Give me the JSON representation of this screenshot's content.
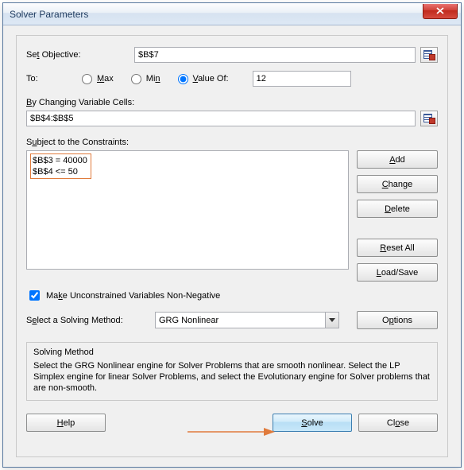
{
  "window": {
    "title": "Solver Parameters"
  },
  "objective": {
    "label_prefix": "Se",
    "label_under": "t",
    "label_suffix": " Objective:",
    "value": "$B$7"
  },
  "to": {
    "label": "To:",
    "max": {
      "under": "M",
      "rest": "ax"
    },
    "min": {
      "pre": "Mi",
      "under": "n"
    },
    "valueof": {
      "under": "V",
      "rest": "alue Of:"
    },
    "selected": "valueof",
    "value_input": "12"
  },
  "changing": {
    "under": "B",
    "rest": "y Changing Variable Cells:",
    "value": "$B$4:$B$5"
  },
  "constraints": {
    "label_pre": "S",
    "label_under": "u",
    "label_post": "bject to the Constraints:",
    "items": [
      "$B$3 = 40000",
      "$B$4 <= 50"
    ],
    "add": {
      "under": "A",
      "rest": "dd"
    },
    "change": {
      "under": "C",
      "rest": "hange"
    },
    "delete": {
      "under": "D",
      "rest": "elete"
    },
    "reset": {
      "under": "R",
      "rest": "eset All"
    },
    "loadsave": {
      "under": "L",
      "rest": "oad/Save"
    }
  },
  "nonneg": {
    "checked": true,
    "pre": "Ma",
    "under": "k",
    "post": "e Unconstrained Variables Non-Negative"
  },
  "method": {
    "label_pre": "S",
    "label_under": "e",
    "label_post": "lect a Solving Method:",
    "value": "GRG Nonlinear",
    "options": {
      "pre": "O",
      "under": "p",
      "post": "tions"
    }
  },
  "info": {
    "title": "Solving Method",
    "text": "Select the GRG Nonlinear engine for Solver Problems that are smooth nonlinear. Select the LP Simplex engine for linear Solver Problems, and select the Evolutionary engine for Solver problems that are non-smooth."
  },
  "footer": {
    "help": {
      "under": "H",
      "rest": "elp"
    },
    "solve": {
      "under": "S",
      "rest": "olve"
    },
    "close": {
      "pre": "Cl",
      "under": "o",
      "post": "se"
    }
  },
  "annotation": {
    "arrow_color": "#e07b3c"
  }
}
